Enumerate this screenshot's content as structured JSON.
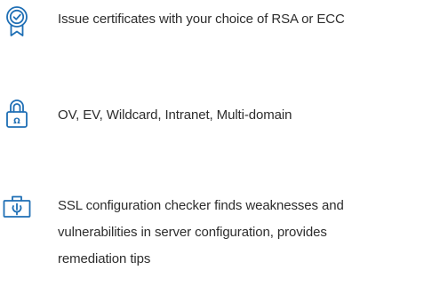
{
  "features": {
    "items": [
      {
        "icon": "certificate-badge-icon",
        "lines": [
          "Issue certificates with your choice of RSA or ECC"
        ]
      },
      {
        "icon": "lock-icon",
        "lines": [
          "OV, EV, Wildcard, Intranet, Multi-domain"
        ]
      },
      {
        "icon": "server-config-icon",
        "lines": [
          "SSL configuration checker finds weaknesses and",
          "vulnerabilities in server configuration, provides",
          "remediation tips"
        ]
      }
    ]
  },
  "colors": {
    "icon_blue": "#1f6fb5",
    "text": "#2d2d2d",
    "background": "#ffffff"
  }
}
